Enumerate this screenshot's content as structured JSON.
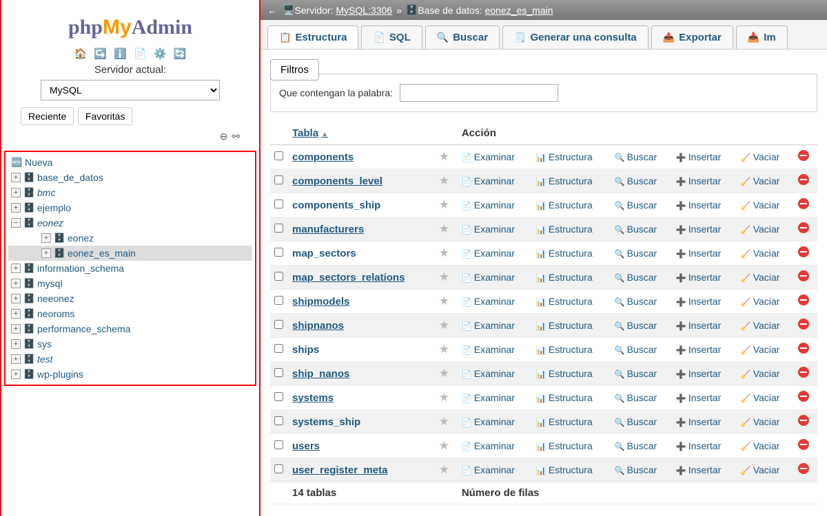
{
  "logo": {
    "php": "php",
    "my": "My",
    "admin": "Admin"
  },
  "sidebar": {
    "server_label": "Servidor actual:",
    "server_value": "MySQL",
    "recent": "Reciente",
    "favorites": "Favoritas",
    "new_label": "Nueva",
    "tree": [
      {
        "name": "base_de_datos",
        "italic": false
      },
      {
        "name": "bmc",
        "italic": true
      },
      {
        "name": "ejemplo",
        "italic": false
      },
      {
        "name": "eonez",
        "italic": true,
        "expanded": true,
        "children": [
          {
            "name": "eonez"
          },
          {
            "name": "eonez_es_main",
            "selected": true
          }
        ]
      },
      {
        "name": "information_schema",
        "italic": false
      },
      {
        "name": "mysql",
        "italic": false
      },
      {
        "name": "neeonez",
        "italic": false
      },
      {
        "name": "neoroms",
        "italic": false
      },
      {
        "name": "performance_schema",
        "italic": false
      },
      {
        "name": "sys",
        "italic": false
      },
      {
        "name": "test",
        "italic": true
      },
      {
        "name": "wp-plugins",
        "italic": false
      }
    ]
  },
  "breadcrumb": {
    "server_prefix": "Servidor:",
    "server": "MySQL:3306",
    "db_prefix": "Base de datos:",
    "db": "eonez_es_main"
  },
  "tabs": {
    "structure": "Estructura",
    "sql": "SQL",
    "search": "Buscar",
    "query": "Generar una consulta",
    "export": "Exportar",
    "import": "Im"
  },
  "filters": {
    "button": "Filtros",
    "label": "Que contengan la palabra:",
    "value": ""
  },
  "table_header": {
    "table": "Tabla",
    "action": "Acción"
  },
  "actions": {
    "browse": "Examinar",
    "structure": "Estructura",
    "search": "Buscar",
    "insert": "Insertar",
    "empty": "Vaciar"
  },
  "tables": [
    {
      "name": "components",
      "u": true
    },
    {
      "name": "components_level",
      "u": true
    },
    {
      "name": "components_ship"
    },
    {
      "name": "manufacturers",
      "u": true
    },
    {
      "name": "map_sectors"
    },
    {
      "name": "map_sectors_relations",
      "u": true
    },
    {
      "name": "shipmodels",
      "u": true
    },
    {
      "name": "shipnanos",
      "u": true
    },
    {
      "name": "ships"
    },
    {
      "name": "ship_nanos",
      "u": true
    },
    {
      "name": "systems",
      "u": true
    },
    {
      "name": "systems_ship"
    },
    {
      "name": "users",
      "u": true
    },
    {
      "name": "user_register_meta",
      "u": true
    }
  ],
  "footer": {
    "count": "14 tablas",
    "rows_label": "Número de filas"
  }
}
